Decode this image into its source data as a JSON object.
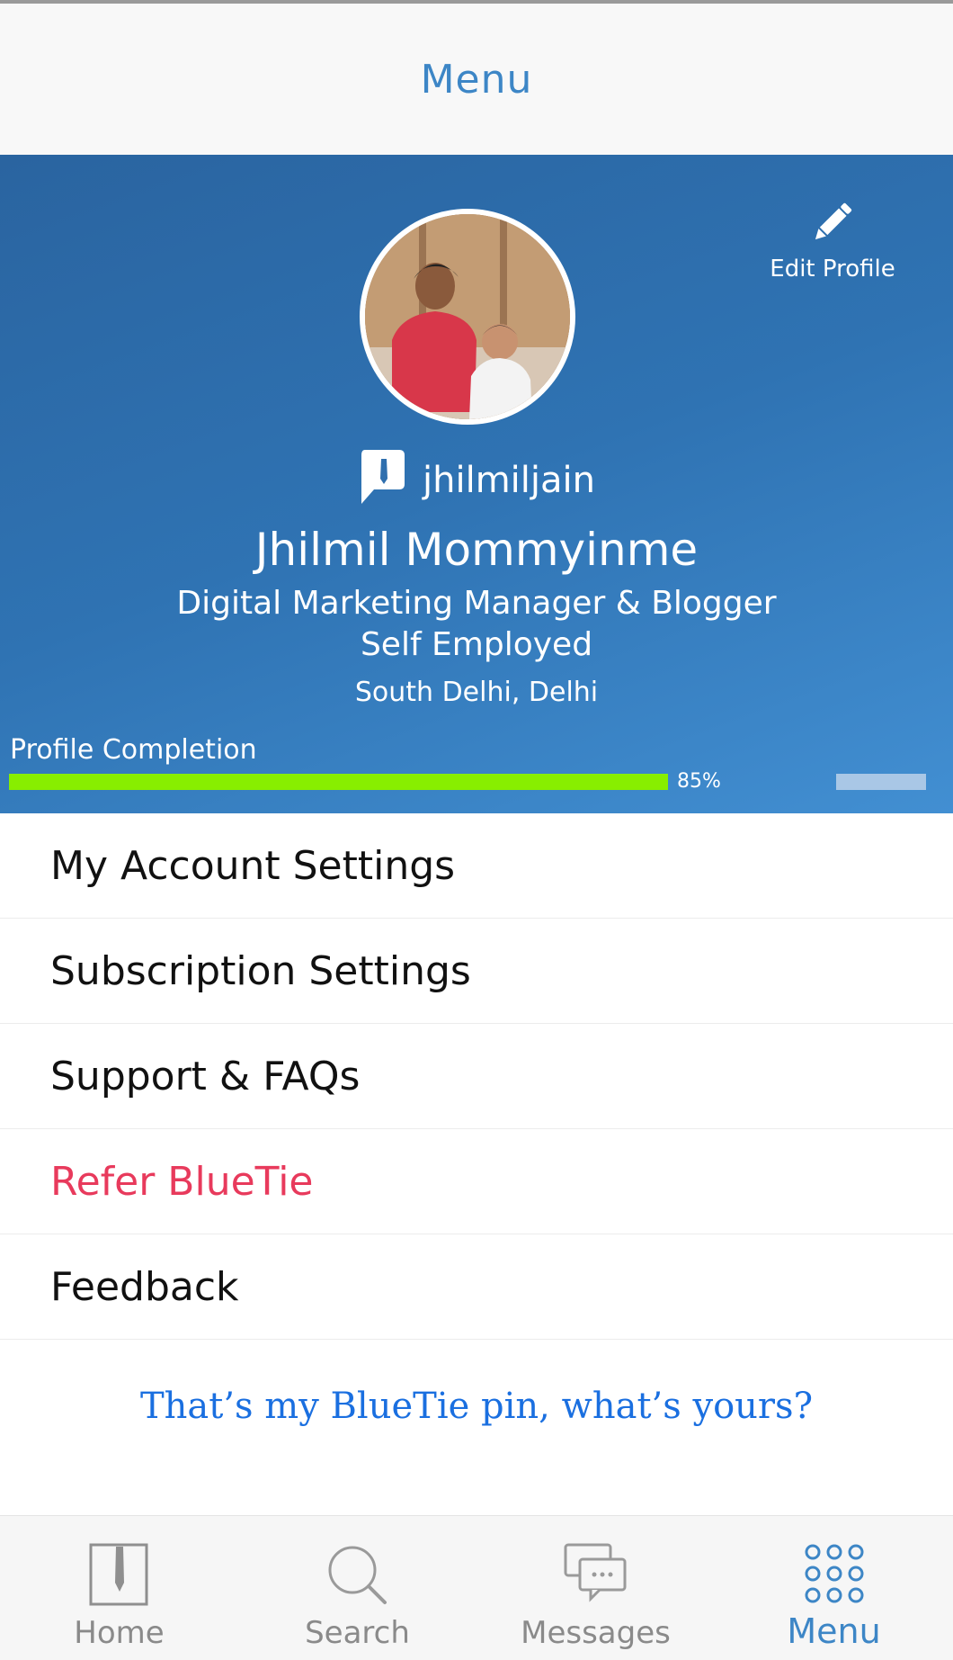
{
  "header": {
    "title": "Menu"
  },
  "profile": {
    "edit_label": "Edit Profile",
    "handle": "jhilmiljain",
    "name": "Jhilmil Mommyinme",
    "role": "Digital Marketing Manager & Blogger",
    "company": "Self Employed",
    "location": "South Delhi, Delhi",
    "completion_label": "Profile Completion",
    "completion_percent": 85,
    "completion_text": "85%"
  },
  "menu": {
    "items": [
      {
        "label": "My Account Settings"
      },
      {
        "label": "Subscription Settings"
      },
      {
        "label": "Support & FAQs"
      },
      {
        "label": "Refer BlueTie"
      },
      {
        "label": "Feedback"
      }
    ]
  },
  "pin_text": "That’s my BlueTie pin, what’s yours?",
  "tabs": [
    {
      "label": "Home",
      "icon": "home-icon"
    },
    {
      "label": "Search",
      "icon": "search-icon"
    },
    {
      "label": "Messages",
      "icon": "messages-icon"
    },
    {
      "label": "Menu",
      "icon": "menu-grid-icon",
      "active": true
    }
  ],
  "colors": {
    "accent": "#3d86c6",
    "hero_gradient_start": "#2a64a0",
    "hero_gradient_end": "#428fd2",
    "progress_fill": "#88ee00",
    "refer_text": "#e83a5c",
    "pin_text": "#1a6fe0"
  }
}
